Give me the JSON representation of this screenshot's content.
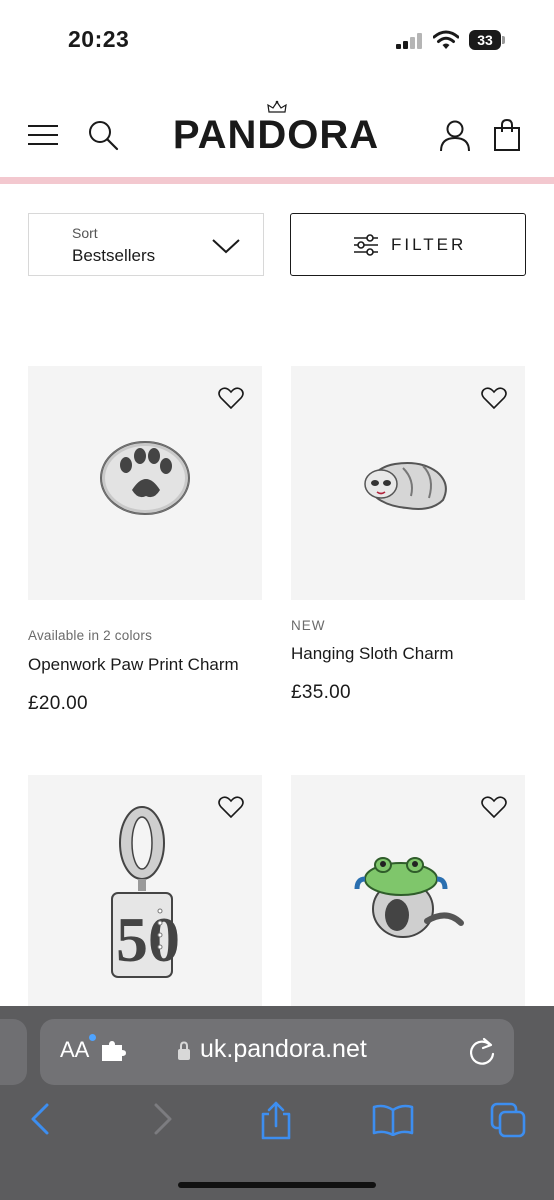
{
  "status_bar": {
    "time": "20:23",
    "battery": "33"
  },
  "header": {
    "brand": "PANDORA",
    "accent_color": "#f3c8cf"
  },
  "sort": {
    "label": "Sort",
    "value": "Bestsellers"
  },
  "filter": {
    "label": "FILTER"
  },
  "products": [
    {
      "subtitle": "Available in 2 colors",
      "name": "Openwork Paw Print Charm",
      "price": "£20.00",
      "image": "paw-print-charm"
    },
    {
      "subtitle": "NEW",
      "name": "Hanging Sloth Charm",
      "price": "£35.00",
      "image": "sloth-charm"
    },
    {
      "subtitle": "",
      "name": "",
      "price": "",
      "image": "number-50-dangle-charm"
    },
    {
      "subtitle": "",
      "name": "",
      "price": "",
      "image": "frog-charm"
    }
  ],
  "browser": {
    "url": "uk.pandora.net",
    "reader_label": "AA"
  }
}
